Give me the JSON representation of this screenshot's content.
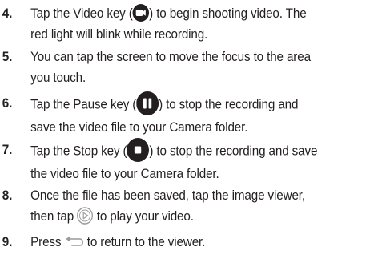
{
  "steps": [
    {
      "number": "4.",
      "line1_before": "Tap the Video key (",
      "line1_icon": "video-camera-icon",
      "line1_after": ") to begin shooting video. The",
      "line2": "red light will blink while recording."
    },
    {
      "number": "5.",
      "line1": "You can tap the screen to move the focus to the area",
      "line2": "you touch."
    },
    {
      "number": "6.",
      "line1_before": "Tap the Pause key (",
      "line1_icon": "pause-icon",
      "line1_after": ") to stop the recording and",
      "line2": "save the video file to your Camera folder."
    },
    {
      "number": "7.",
      "line1_before": "Tap the Stop key (",
      "line1_icon": "stop-icon",
      "line1_after": ") to stop the recording and save",
      "line2": "the video file to your Camera folder."
    },
    {
      "number": "8.",
      "line1": "Once the file has been saved, tap the image viewer,",
      "line2_before": "then tap ",
      "line2_icon": "play-icon",
      "line2_after": " to play your video."
    },
    {
      "number": "9.",
      "line1_before": "Press ",
      "line1_icon": "back-arrow-icon",
      "line1_after": " to return to the viewer."
    }
  ],
  "colors": {
    "text": "#231f20",
    "icon_fill": "#231f20",
    "play_outline": "#9a9a9a"
  }
}
